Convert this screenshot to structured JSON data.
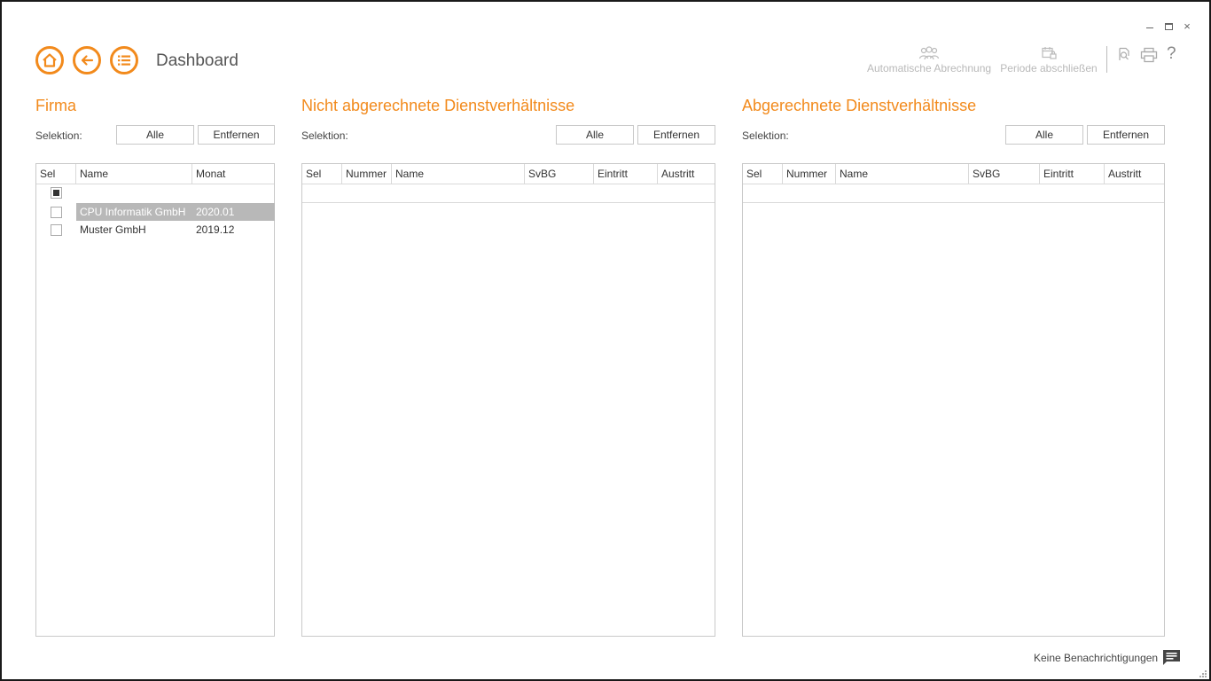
{
  "window": {
    "controls": [
      "minimize",
      "maximize",
      "close"
    ],
    "close_glyph": "×"
  },
  "nav": {
    "title": "Dashboard",
    "buttons": [
      "home-icon",
      "back-arrow-icon",
      "list-menu-icon"
    ],
    "accent": "#f28a1c"
  },
  "toolbar": {
    "auto_label": "Automatische Abrechnung",
    "periode_label": "Periode abschließen",
    "help_glyph": "?"
  },
  "firma": {
    "title": "Firma",
    "selektion_label": "Selektion:",
    "btn_alle": "Alle",
    "btn_entfernen": "Entfernen",
    "columns": [
      "Sel",
      "Name",
      "Monat"
    ],
    "rows": [
      {
        "name": "CPU Informatik GmbH",
        "monat": "2020.01",
        "selected": true
      },
      {
        "name": "Muster GmbH",
        "monat": "2019.12",
        "selected": false
      }
    ]
  },
  "nicht": {
    "title": "Nicht abgerechnete Dienstverhältnisse",
    "selektion_label": "Selektion:",
    "btn_alle": "Alle",
    "btn_entfernen": "Entfernen",
    "columns": [
      "Sel",
      "Nummer",
      "Name",
      "SvBG",
      "Eintritt",
      "Austritt"
    ]
  },
  "abger": {
    "title": "Abgerechnete Dienstverhältnisse",
    "selektion_label": "Selektion:",
    "btn_alle": "Alle",
    "btn_entfernen": "Entfernen",
    "columns": [
      "Sel",
      "Nummer",
      "Name",
      "SvBG",
      "Eintritt",
      "Austritt"
    ]
  },
  "footer": {
    "notifications": "Keine Benachrichtigungen"
  }
}
